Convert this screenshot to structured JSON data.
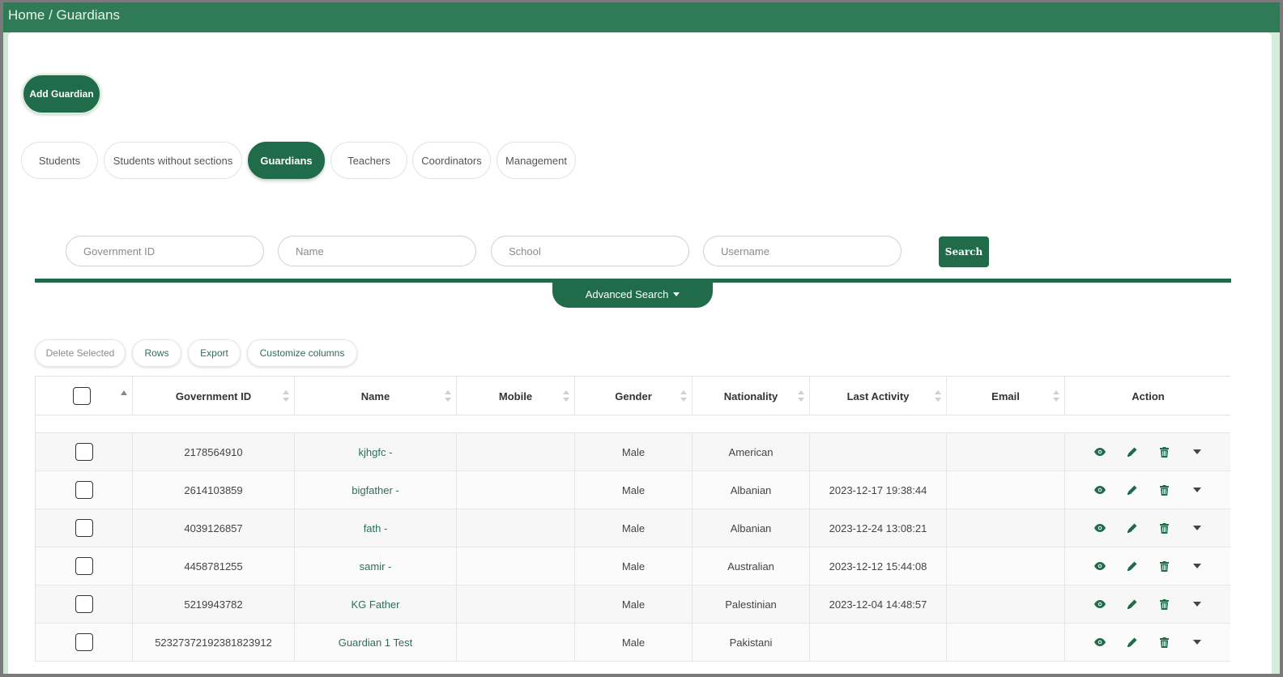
{
  "breadcrumb": {
    "home": "Home",
    "separator": " / ",
    "current": "Guardians"
  },
  "add_button": "Add Guardian",
  "tabs": [
    {
      "label": "Students",
      "active": false
    },
    {
      "label": "Students without sections",
      "active": false
    },
    {
      "label": "Guardians",
      "active": true
    },
    {
      "label": "Teachers",
      "active": false
    },
    {
      "label": "Coordinators",
      "active": false
    },
    {
      "label": "Management",
      "active": false
    }
  ],
  "search": {
    "government_id_placeholder": "Government ID",
    "name_placeholder": "Name",
    "school_placeholder": "School",
    "username_placeholder": "Username",
    "search_label": "Search",
    "advanced_label": "Advanced Search"
  },
  "toolbar": {
    "delete_selected": "Delete Selected",
    "rows": "Rows",
    "export": "Export",
    "customize_columns": "Customize columns"
  },
  "table": {
    "columns": [
      "Government ID",
      "Name",
      "Mobile",
      "Gender",
      "Nationality",
      "Last Activity",
      "Email",
      "Action"
    ],
    "rows": [
      {
        "gov_id": "2178564910",
        "name": "kjhgfc -",
        "mobile": "",
        "gender": "Male",
        "nationality": "American",
        "last_activity": "",
        "email": ""
      },
      {
        "gov_id": "2614103859",
        "name": "bigfather -",
        "mobile": "",
        "gender": "Male",
        "nationality": "Albanian",
        "last_activity": "2023-12-17 19:38:44",
        "email": ""
      },
      {
        "gov_id": "4039126857",
        "name": "fath -",
        "mobile": "",
        "gender": "Male",
        "nationality": "Albanian",
        "last_activity": "2023-12-24 13:08:21",
        "email": ""
      },
      {
        "gov_id": "4458781255",
        "name": "samir -",
        "mobile": "",
        "gender": "Male",
        "nationality": "Australian",
        "last_activity": "2023-12-12 15:44:08",
        "email": ""
      },
      {
        "gov_id": "5219943782",
        "name": "KG Father",
        "mobile": "",
        "gender": "Male",
        "nationality": "Palestinian",
        "last_activity": "2023-12-04 14:48:57",
        "email": ""
      },
      {
        "gov_id": "52327372192381823912",
        "name": "Guardian 1 Test",
        "mobile": "",
        "gender": "Male",
        "nationality": "Pakistani",
        "last_activity": "",
        "email": ""
      }
    ],
    "action_icons": [
      "eye-icon",
      "pencil-icon",
      "trash-icon",
      "caret-down-icon"
    ]
  },
  "colors": {
    "brand": "#206b4a",
    "topbar": "#2f7a57"
  }
}
